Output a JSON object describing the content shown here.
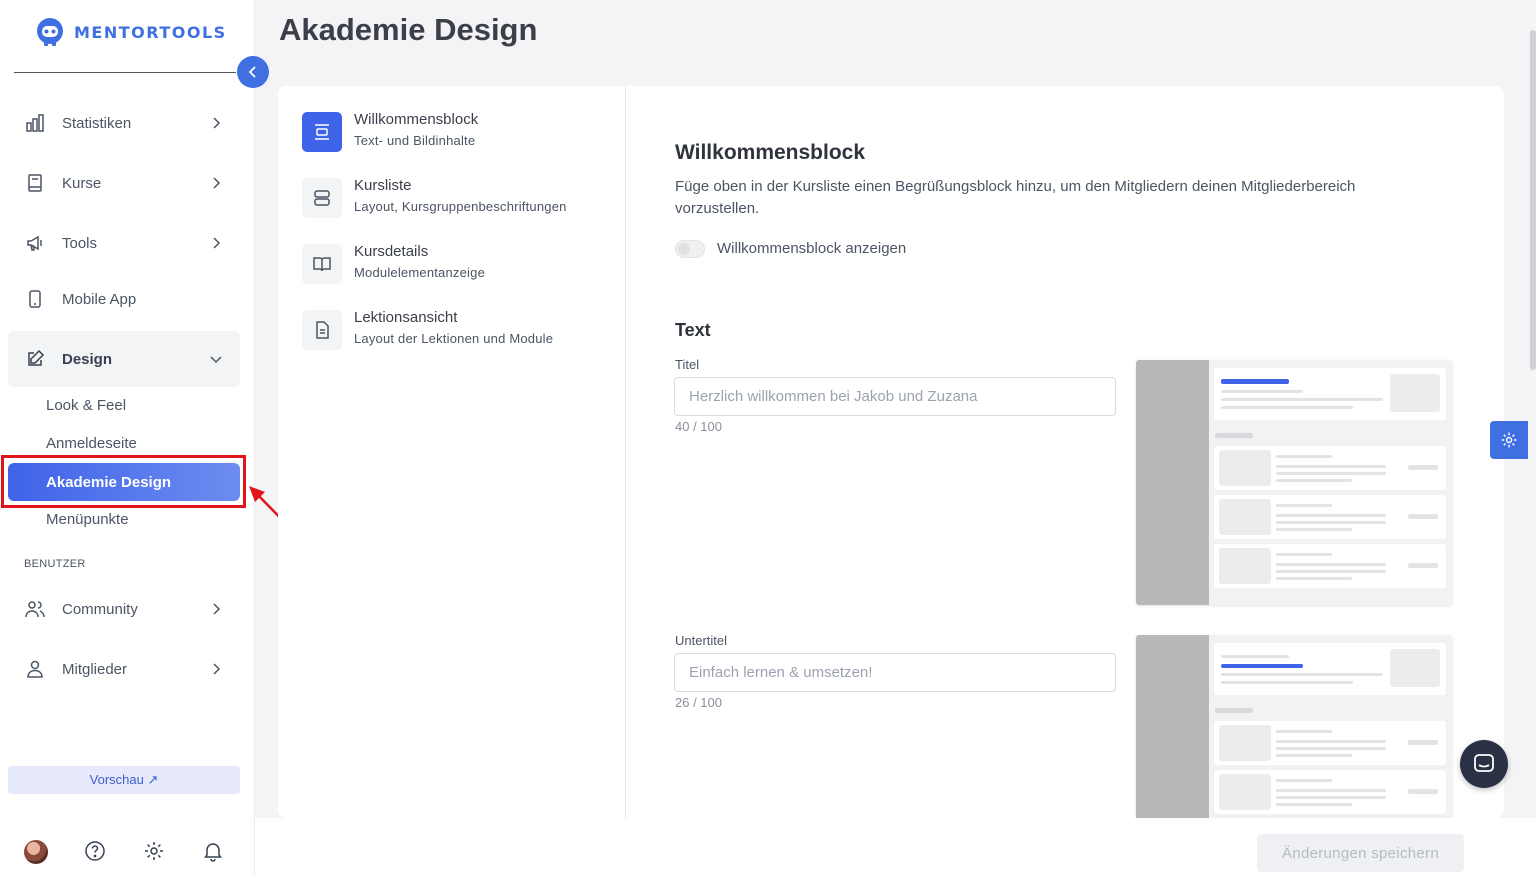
{
  "brand": {
    "name": "MENTORTOOLS",
    "accent": "#3f6fe0"
  },
  "sidebar": {
    "nav": [
      {
        "label": "Statistiken",
        "icon": "bar-chart-icon"
      },
      {
        "label": "Kurse",
        "icon": "book-icon"
      },
      {
        "label": "Tools",
        "icon": "megaphone-icon"
      },
      {
        "label": "Mobile App",
        "icon": "mobile-icon"
      },
      {
        "label": "Design",
        "icon": "edit-icon"
      }
    ],
    "design_sub": [
      "Look & Feel",
      "Anmeldeseite",
      "Akademie Design",
      "Menüpunkte"
    ],
    "section_label": "BENUTZER",
    "user_nav": [
      {
        "label": "Community",
        "icon": "users-icon"
      },
      {
        "label": "Mitglieder",
        "icon": "user-icon"
      }
    ],
    "preview_label": "Vorschau ↗"
  },
  "page": {
    "title": "Akademie Design",
    "sections": [
      {
        "title": "Willkommensblock",
        "subtitle": "Text- und Bildinhalte",
        "active": true
      },
      {
        "title": "Kursliste",
        "subtitle": "Layout, Kursgruppenbeschriftungen"
      },
      {
        "title": "Kursdetails",
        "subtitle": "Modulelementanzeige"
      },
      {
        "title": "Lektionsansicht",
        "subtitle": "Layout der Lektionen und Module"
      }
    ],
    "content": {
      "title": "Willkommensblock",
      "description": "Füge oben in der Kursliste einen Begrüßungsblock hinzu, um den Mitgliedern deinen Mitgliederbereich vorzustellen.",
      "toggle_label": "Willkommensblock anzeigen",
      "text_heading": "Text",
      "fields": [
        {
          "label": "Titel",
          "placeholder": "Herzlich willkommen bei Jakob und Zuzana",
          "count": "40 / 100"
        },
        {
          "label": "Untertitel",
          "placeholder": "Einfach lernen & umsetzen!",
          "count": "26 / 100"
        }
      ]
    },
    "save_label": "Änderungen speichern"
  }
}
